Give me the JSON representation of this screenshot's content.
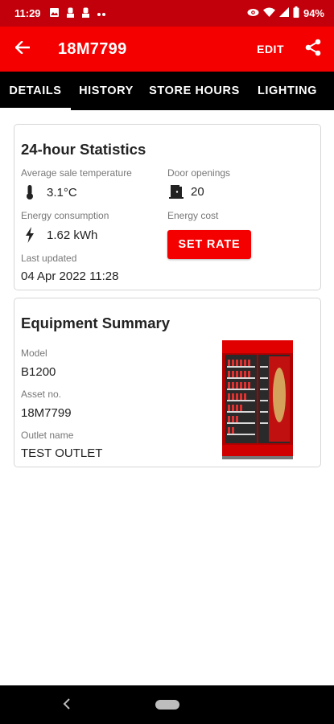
{
  "status_bar": {
    "time": "11:29",
    "battery": "94%",
    "left_icons": [
      "image-icon",
      "person-icon",
      "person-icon",
      "more-icon"
    ],
    "right_icons": [
      "eye-icon",
      "wifi-icon",
      "signal-icon",
      "battery-icon"
    ]
  },
  "app_bar": {
    "title": "18M7799",
    "edit_label": "EDIT",
    "bg_color": "#f40000"
  },
  "tabs": [
    {
      "label": "DETAILS",
      "active": true
    },
    {
      "label": "HISTORY",
      "active": false
    },
    {
      "label": "STORE HOURS",
      "active": false
    },
    {
      "label": "LIGHTING",
      "active": false
    }
  ],
  "statistics": {
    "title": "24-hour Statistics",
    "avg_temp_label": "Average sale temperature",
    "avg_temp_value": "3.1°C",
    "door_openings_label": "Door openings",
    "door_openings_value": "20",
    "energy_consumption_label": "Energy consumption",
    "energy_consumption_value": "1.62 kWh",
    "energy_cost_label": "Energy cost",
    "set_rate_label": "SET RATE",
    "last_updated_label": "Last updated",
    "last_updated_value": "04 Apr 2022 11:28"
  },
  "equipment": {
    "title": "Equipment Summary",
    "model_label": "Model",
    "model_value": "B1200",
    "asset_label": "Asset no.",
    "asset_value": "18M7799",
    "outlet_label": "Outlet name",
    "outlet_value": "TEST OUTLET",
    "image": "red-beverage-cooler-image"
  },
  "colors": {
    "accent": "#f40000",
    "status_bar": "#c2000b",
    "tab_bar": "#000000"
  }
}
